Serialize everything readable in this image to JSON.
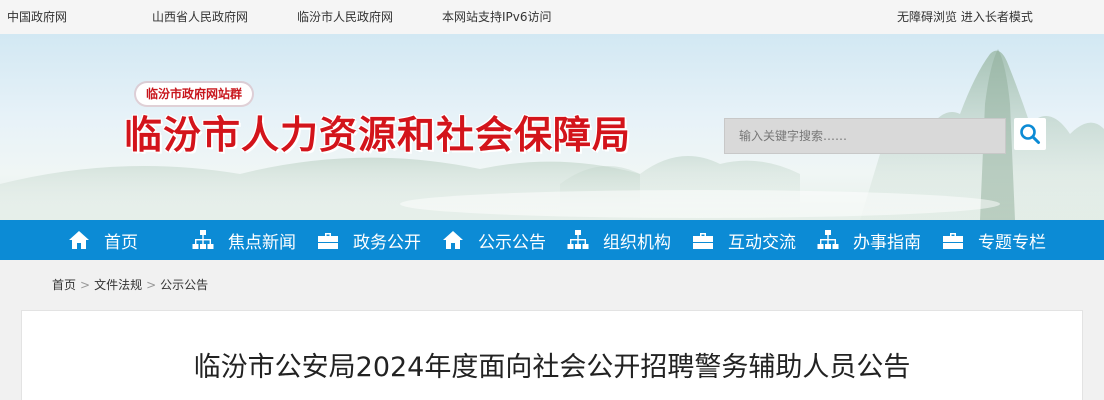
{
  "topbar": {
    "links": [
      "中国政府网",
      "山西省人民政府网",
      "临汾市人民政府网",
      "本网站支持IPv6访问"
    ],
    "accessibility": "无障碍浏览  进入长者模式"
  },
  "banner": {
    "site_group": "临汾市政府网站群",
    "site_title": "临汾市人力资源和社会保障局",
    "search_placeholder": "输入关键字搜索……"
  },
  "nav": {
    "items": [
      {
        "label": "首页",
        "icon": "home-icon"
      },
      {
        "label": "焦点新闻",
        "icon": "sitemap-icon"
      },
      {
        "label": "政务公开",
        "icon": "briefcase-icon"
      },
      {
        "label": "公示公告",
        "icon": "home-icon"
      },
      {
        "label": "组织机构",
        "icon": "sitemap-icon"
      },
      {
        "label": "互动交流",
        "icon": "briefcase-icon"
      },
      {
        "label": "办事指南",
        "icon": "sitemap-icon"
      },
      {
        "label": "专题专栏",
        "icon": "briefcase-icon"
      }
    ]
  },
  "breadcrumb": {
    "items": [
      "首页",
      "文件法规",
      "公示公告"
    ],
    "separator": ">"
  },
  "article": {
    "title": "临汾市公安局2024年度面向社会公开招聘警务辅助人员公告"
  },
  "colors": {
    "nav_bg": "#0c8bd5",
    "title_red": "#d3141b",
    "search_icon": "#0c8bd5"
  }
}
